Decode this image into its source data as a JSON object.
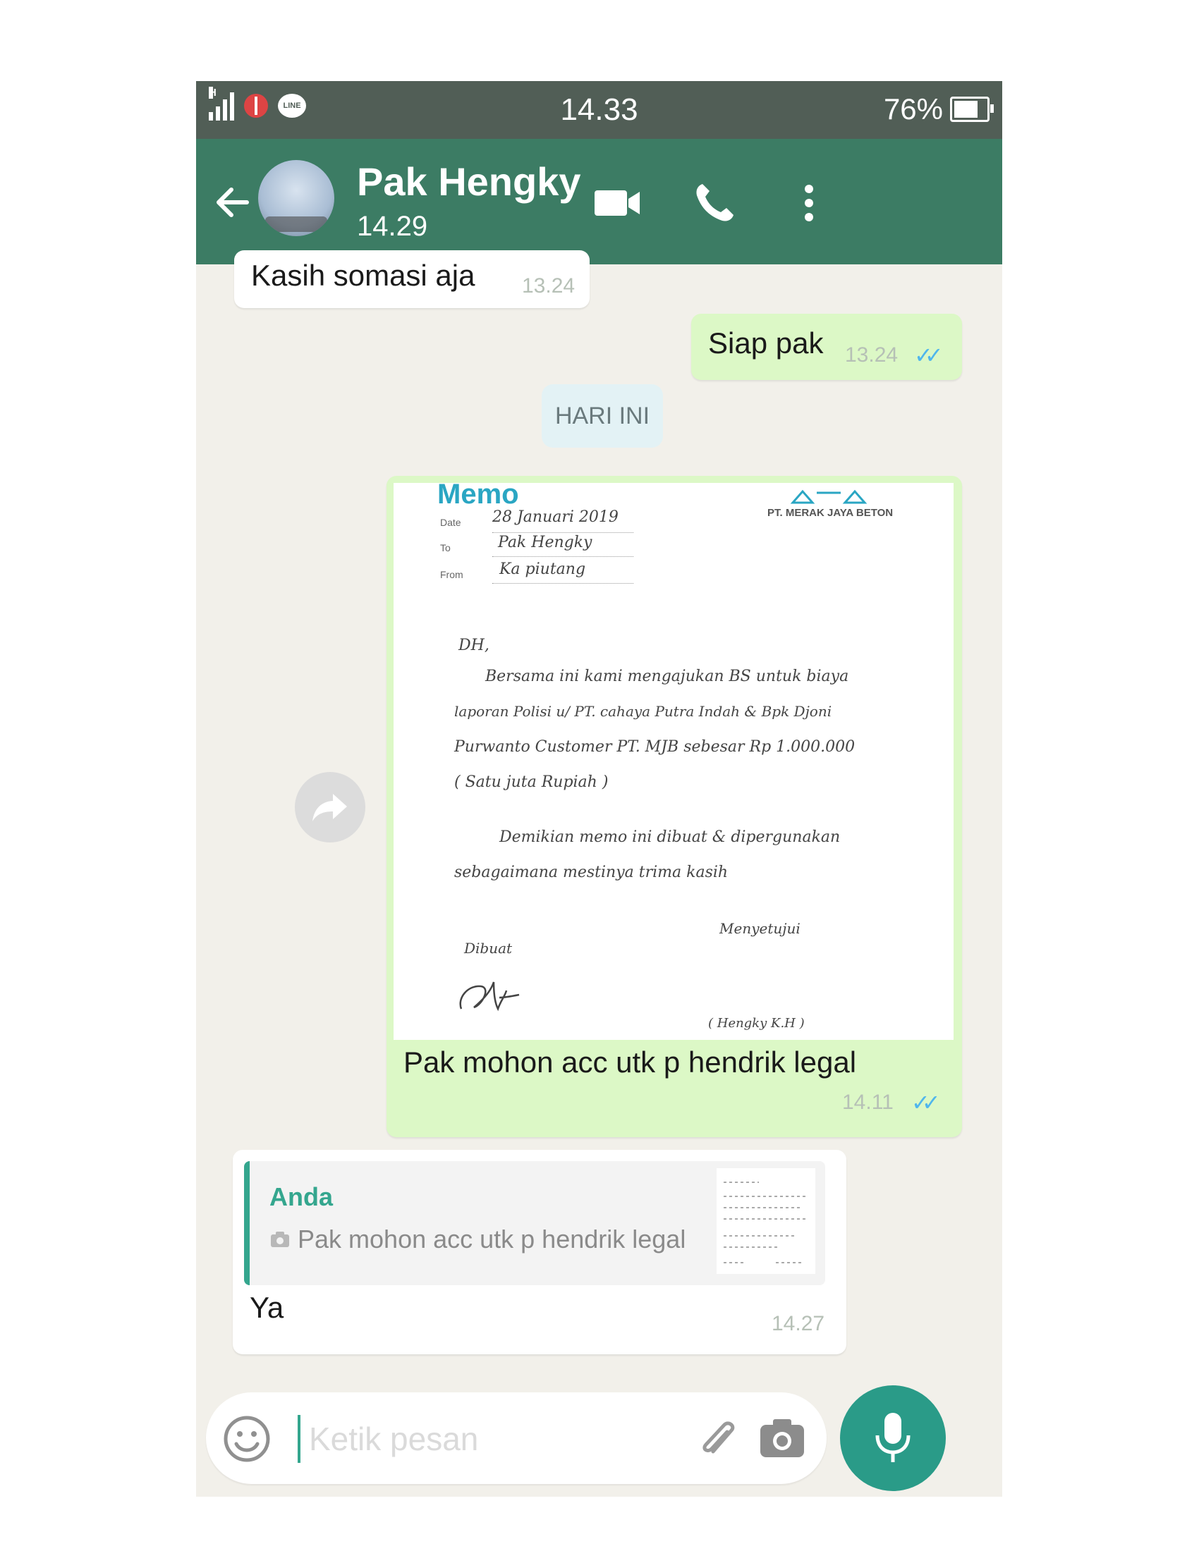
{
  "status_bar": {
    "network": "H",
    "app_icon": "LINE",
    "time": "14.33",
    "battery": "76%",
    "battery_level": 0.76
  },
  "header": {
    "contact_name": "Pak Hengky",
    "subtitle": "14.29",
    "icons": [
      "back-arrow-icon",
      "video-call-icon",
      "phone-icon",
      "more-options-icon"
    ]
  },
  "messages": [
    {
      "direction": "in",
      "text": "Kasih somasi aja",
      "time": "13.24"
    },
    {
      "direction": "out",
      "text": "Siap pak",
      "time": "13.24",
      "status": "read"
    }
  ],
  "day_separator": "HARI INI",
  "image_message": {
    "caption": "Pak mohon acc utk p hendrik legal",
    "time": "14.11",
    "status": "read",
    "memo": {
      "title": "Memo",
      "company": "PT. MERAK JAYA BETON",
      "labels": {
        "date": "Date",
        "to": "To",
        "from": "From"
      },
      "date_value": "28 Januari 2019",
      "to_value": "Pak Hengky",
      "from_value": "Ka piutang",
      "greeting": "DH,",
      "body_lines": [
        "Bersama ini kami mengajukan BS untuk biaya",
        "laporan Polisi u/ PT. cahaya Putra Indah & Bpk Djoni",
        "Purwanto Customer PT. MJB sebesar Rp 1.000.000",
        "( Satu juta Rupiah )"
      ],
      "closing_lines": [
        "Demikian memo ini dibuat & dipergunakan",
        "sebagaimana mestinya trima kasih"
      ],
      "made_by_label": "Dibuat",
      "approved_label": "Menyetujui",
      "approver_name": "( Hengky K.H )"
    }
  },
  "reply_message": {
    "quote_author": "Anda",
    "quote_text": "Pak mohon acc utk p hendrik legal",
    "text": "Ya",
    "time": "14.27"
  },
  "input_bar": {
    "placeholder": "Ketik pesan"
  },
  "colors": {
    "header": "#3c7c64",
    "status_bar": "#515e56",
    "outgoing_bubble": "#dcf8c6",
    "incoming_bubble": "#ffffff",
    "accent": "#34a68e",
    "read_ticks": "#4fb6ec"
  }
}
